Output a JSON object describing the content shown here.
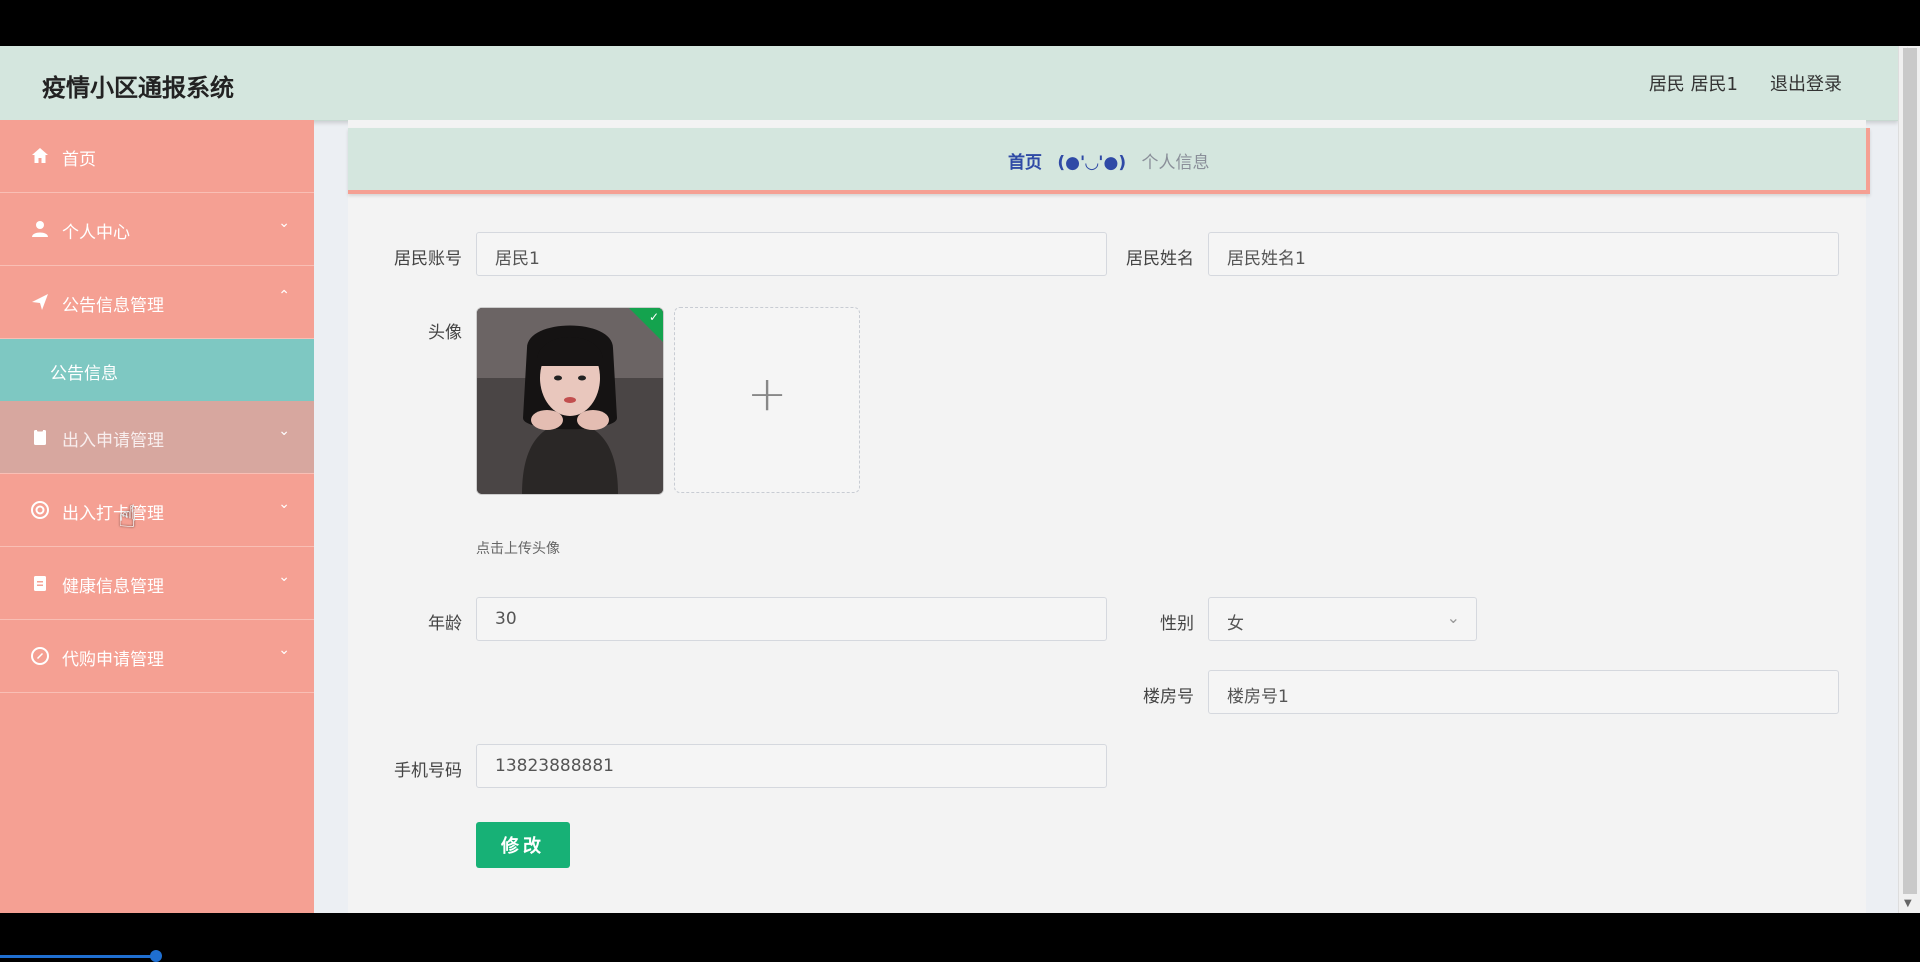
{
  "app": {
    "title": "疫情小区通报系统",
    "user_role": "居民",
    "user_name": "居民1",
    "logout": "退出登录"
  },
  "sidebar": {
    "items": [
      {
        "label": "首页",
        "icon": "home-icon"
      },
      {
        "label": "个人中心",
        "icon": "user-icon",
        "chevron": "⌄"
      },
      {
        "label": "公告信息管理",
        "icon": "send-icon",
        "chevron": "⌃"
      },
      {
        "label": "出入申请管理",
        "icon": "clipboard-icon",
        "chevron": "⌄"
      },
      {
        "label": "出入打卡管理",
        "icon": "lifebuoy-icon",
        "chevron": "⌄"
      },
      {
        "label": "健康信息管理",
        "icon": "doc-icon",
        "chevron": "⌄"
      },
      {
        "label": "代购申请管理",
        "icon": "compass-icon",
        "chevron": "⌄"
      }
    ],
    "submenu": {
      "label": "公告信息"
    }
  },
  "breadcrumb": {
    "home": "首页",
    "separator": "(●'◡'●)",
    "current": "个人信息"
  },
  "form": {
    "account_label": "居民账号",
    "account_value": "居民1",
    "name_label": "居民姓名",
    "name_value": "居民姓名1",
    "avatar_label": "头像",
    "upload_hint": "点击上传头像",
    "upload_plus": "+",
    "age_label": "年龄",
    "age_value": "30",
    "gender_label": "性别",
    "gender_value": "女",
    "building_label": "楼房号",
    "building_value": "楼房号1",
    "phone_label": "手机号码",
    "phone_value": "13823888881",
    "submit_label": "修改"
  },
  "colors": {
    "sidebar": "#f5a093",
    "header": "#d4e6de",
    "active_submenu": "#7ec8c2",
    "primary_button": "#17b176"
  }
}
